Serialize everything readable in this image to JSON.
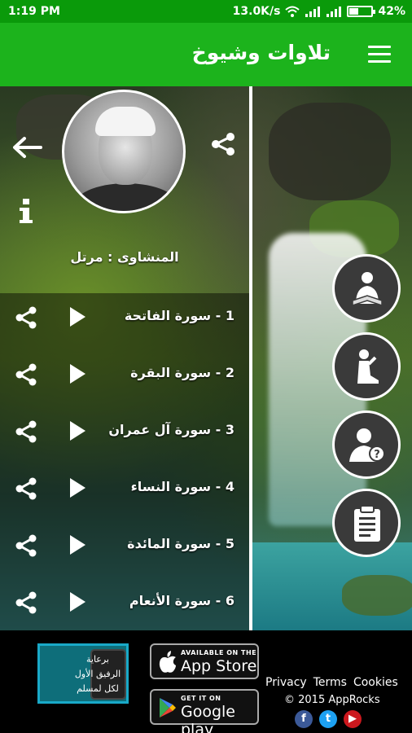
{
  "status_bar": {
    "time": "1:19 PM",
    "network_speed": "13.0K/s",
    "battery": "42%",
    "battery_level": 0.42
  },
  "app_bar": {
    "title": "تلاوات وشيوخ",
    "menu_icon": "hamburger-icon"
  },
  "reciter": {
    "label": "المنشاوى : مرتل"
  },
  "surahs": [
    {
      "label": "1 - سورة الفاتحة"
    },
    {
      "label": "2 - سورة البقرة"
    },
    {
      "label": "3 - سورة آل عمران"
    },
    {
      "label": "4 - سورة النساء"
    },
    {
      "label": "5 - سورة المائدة"
    },
    {
      "label": "6 - سورة الأنعام"
    }
  ],
  "side_buttons": [
    "reading-quran-icon",
    "praying-person-icon",
    "user-question-icon",
    "clipboard-icon"
  ],
  "footer": {
    "promo": {
      "line1": "برعاية",
      "line2": "الرفيق الأول",
      "line3": "لكل لمسلم"
    },
    "app_store": {
      "small": "AVAILABLE ON THE",
      "big": "App Store"
    },
    "google_play": {
      "small": "GET IT ON",
      "big": "Google play"
    },
    "links": {
      "privacy": "Privacy",
      "terms": "Terms",
      "cookies": "Cookies"
    },
    "copyright": "© 2015 AppRocks",
    "social": {
      "facebook": "f",
      "twitter": "t",
      "youtube": "▶"
    }
  },
  "colors": {
    "status_green": "#0a9a0a",
    "appbar_green": "#1cb31c",
    "promo_border": "#19a9c8",
    "facebook": "#3b5998",
    "twitter": "#1da1f2",
    "youtube": "#cc181e"
  }
}
